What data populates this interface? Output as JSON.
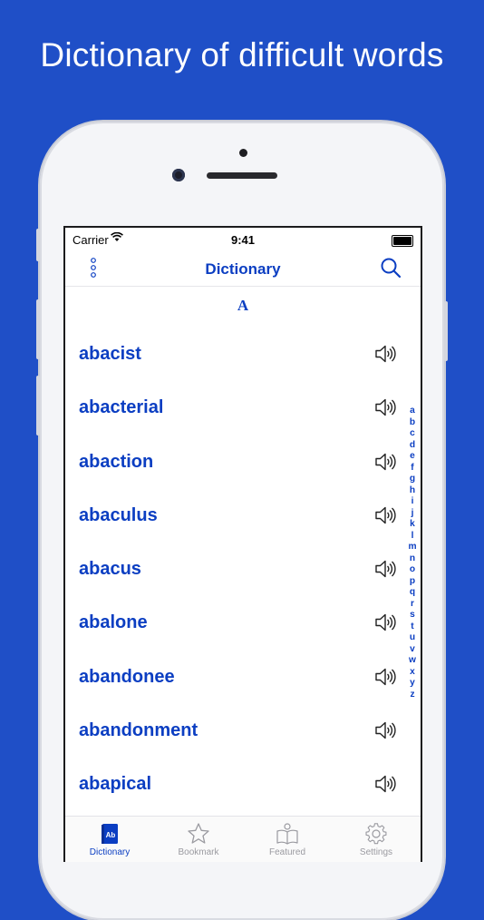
{
  "promo": {
    "headline": "Dictionary of difficult words"
  },
  "status_bar": {
    "carrier": "Carrier",
    "time": "9:41"
  },
  "navbar": {
    "title": "Dictionary"
  },
  "section": {
    "letter": "A"
  },
  "words": [
    {
      "text": "abacist"
    },
    {
      "text": "abacterial"
    },
    {
      "text": "abaction"
    },
    {
      "text": "abaculus"
    },
    {
      "text": "abacus"
    },
    {
      "text": "abalone"
    },
    {
      "text": "abandonee"
    },
    {
      "text": "abandonment"
    },
    {
      "text": "abapical"
    }
  ],
  "alphabet_index": [
    "a",
    "b",
    "c",
    "d",
    "e",
    "f",
    "g",
    "h",
    "i",
    "j",
    "k",
    "l",
    "m",
    "n",
    "o",
    "p",
    "q",
    "r",
    "s",
    "t",
    "u",
    "v",
    "w",
    "x",
    "y",
    "z"
  ],
  "tabbar": {
    "tabs": [
      {
        "label": "Dictionary",
        "icon": "dictionary-book-icon",
        "active": true
      },
      {
        "label": "Bookmark",
        "icon": "star-icon",
        "active": false
      },
      {
        "label": "Featured",
        "icon": "open-book-icon",
        "active": false
      },
      {
        "label": "Settings",
        "icon": "gear-icon",
        "active": false
      }
    ]
  },
  "colors": {
    "background": "#1f4fc7",
    "accent": "#0b3ec2",
    "inactive": "#9a9aa0"
  }
}
